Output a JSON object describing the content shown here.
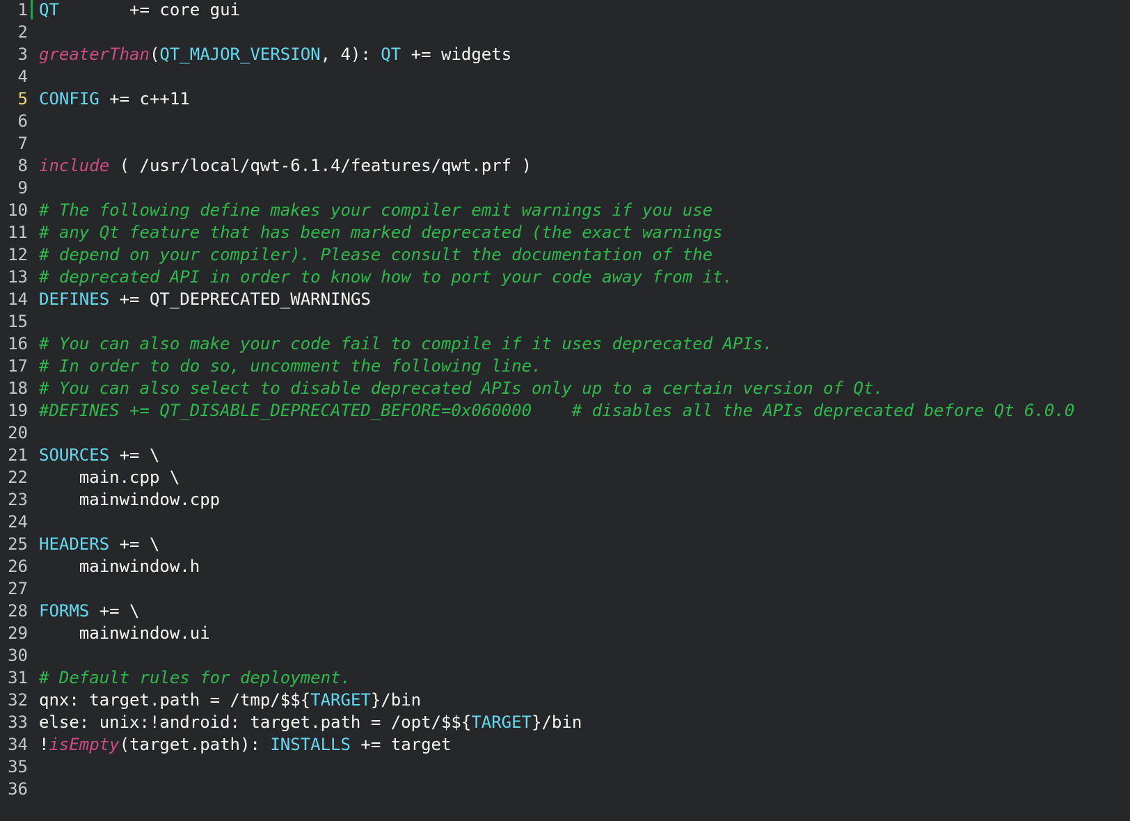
{
  "editor": {
    "current_line": 5,
    "colors": {
      "background": "#26272b",
      "variable": "#66d9ef",
      "function": "#e0508d",
      "comment": "#2fb84a",
      "text": "#f8f8f2",
      "line_number": "#c8c8c8",
      "current_line_number": "#e6db74",
      "cursor_marker": "#2aa14a"
    },
    "lines": [
      {
        "n": "1",
        "tokens": [
          {
            "t": "var",
            "v": "QT"
          },
          {
            "t": "plain",
            "v": "       += core gui"
          }
        ]
      },
      {
        "n": "2",
        "tokens": []
      },
      {
        "n": "3",
        "tokens": [
          {
            "t": "fn",
            "v": "greaterThan"
          },
          {
            "t": "plain",
            "v": "("
          },
          {
            "t": "var",
            "v": "QT_MAJOR_VERSION"
          },
          {
            "t": "plain",
            "v": ", 4): "
          },
          {
            "t": "var",
            "v": "QT"
          },
          {
            "t": "plain",
            "v": " += widgets"
          }
        ]
      },
      {
        "n": "4",
        "tokens": []
      },
      {
        "n": "5",
        "tokens": [
          {
            "t": "var",
            "v": "CONFIG"
          },
          {
            "t": "plain",
            "v": " += c++11"
          }
        ]
      },
      {
        "n": "6",
        "tokens": []
      },
      {
        "n": "7",
        "tokens": []
      },
      {
        "n": "8",
        "tokens": [
          {
            "t": "fn",
            "v": "include"
          },
          {
            "t": "plain",
            "v": " ( /usr/local/qwt-6.1.4/features/qwt.prf )"
          }
        ]
      },
      {
        "n": "9",
        "tokens": []
      },
      {
        "n": "10",
        "tokens": [
          {
            "t": "comment",
            "v": "# The following define makes your compiler emit warnings if you use"
          }
        ]
      },
      {
        "n": "11",
        "tokens": [
          {
            "t": "comment",
            "v": "# any Qt feature that has been marked deprecated (the exact warnings"
          }
        ]
      },
      {
        "n": "12",
        "tokens": [
          {
            "t": "comment",
            "v": "# depend on your compiler). Please consult the documentation of the"
          }
        ]
      },
      {
        "n": "13",
        "tokens": [
          {
            "t": "comment",
            "v": "# deprecated API in order to know how to port your code away from it."
          }
        ]
      },
      {
        "n": "14",
        "tokens": [
          {
            "t": "var",
            "v": "DEFINES"
          },
          {
            "t": "plain",
            "v": " += QT_DEPRECATED_WARNINGS"
          }
        ]
      },
      {
        "n": "15",
        "tokens": []
      },
      {
        "n": "16",
        "tokens": [
          {
            "t": "comment",
            "v": "# You can also make your code fail to compile if it uses deprecated APIs."
          }
        ]
      },
      {
        "n": "17",
        "tokens": [
          {
            "t": "comment",
            "v": "# In order to do so, uncomment the following line."
          }
        ]
      },
      {
        "n": "18",
        "tokens": [
          {
            "t": "comment",
            "v": "# You can also select to disable deprecated APIs only up to a certain version of Qt."
          }
        ]
      },
      {
        "n": "19",
        "tokens": [
          {
            "t": "comment",
            "v": "#DEFINES += QT_DISABLE_DEPRECATED_BEFORE=0x060000    # disables all the APIs deprecated before Qt 6.0.0"
          }
        ]
      },
      {
        "n": "20",
        "tokens": []
      },
      {
        "n": "21",
        "tokens": [
          {
            "t": "var",
            "v": "SOURCES"
          },
          {
            "t": "plain",
            "v": " += \\"
          }
        ]
      },
      {
        "n": "22",
        "tokens": [
          {
            "t": "plain",
            "v": "    main.cpp \\"
          }
        ]
      },
      {
        "n": "23",
        "tokens": [
          {
            "t": "plain",
            "v": "    mainwindow.cpp"
          }
        ]
      },
      {
        "n": "24",
        "tokens": []
      },
      {
        "n": "25",
        "tokens": [
          {
            "t": "var",
            "v": "HEADERS"
          },
          {
            "t": "plain",
            "v": " += \\"
          }
        ]
      },
      {
        "n": "26",
        "tokens": [
          {
            "t": "plain",
            "v": "    mainwindow.h"
          }
        ]
      },
      {
        "n": "27",
        "tokens": []
      },
      {
        "n": "28",
        "tokens": [
          {
            "t": "var",
            "v": "FORMS"
          },
          {
            "t": "plain",
            "v": " += \\"
          }
        ]
      },
      {
        "n": "29",
        "tokens": [
          {
            "t": "plain",
            "v": "    mainwindow.ui"
          }
        ]
      },
      {
        "n": "30",
        "tokens": []
      },
      {
        "n": "31",
        "tokens": [
          {
            "t": "comment",
            "v": "# Default rules for deployment."
          }
        ]
      },
      {
        "n": "32",
        "tokens": [
          {
            "t": "plain",
            "v": "qnx: target.path = /tmp/$${"
          },
          {
            "t": "var",
            "v": "TARGET"
          },
          {
            "t": "plain",
            "v": "}/bin"
          }
        ]
      },
      {
        "n": "33",
        "tokens": [
          {
            "t": "plain",
            "v": "else: unix:!android: target.path = /opt/$${"
          },
          {
            "t": "var",
            "v": "TARGET"
          },
          {
            "t": "plain",
            "v": "}/bin"
          }
        ]
      },
      {
        "n": "34",
        "tokens": [
          {
            "t": "plain",
            "v": "!"
          },
          {
            "t": "fn",
            "v": "isEmpty"
          },
          {
            "t": "plain",
            "v": "(target.path): "
          },
          {
            "t": "var",
            "v": "INSTALLS"
          },
          {
            "t": "plain",
            "v": " += target"
          }
        ]
      },
      {
        "n": "35",
        "tokens": []
      },
      {
        "n": "36",
        "tokens": []
      }
    ]
  }
}
